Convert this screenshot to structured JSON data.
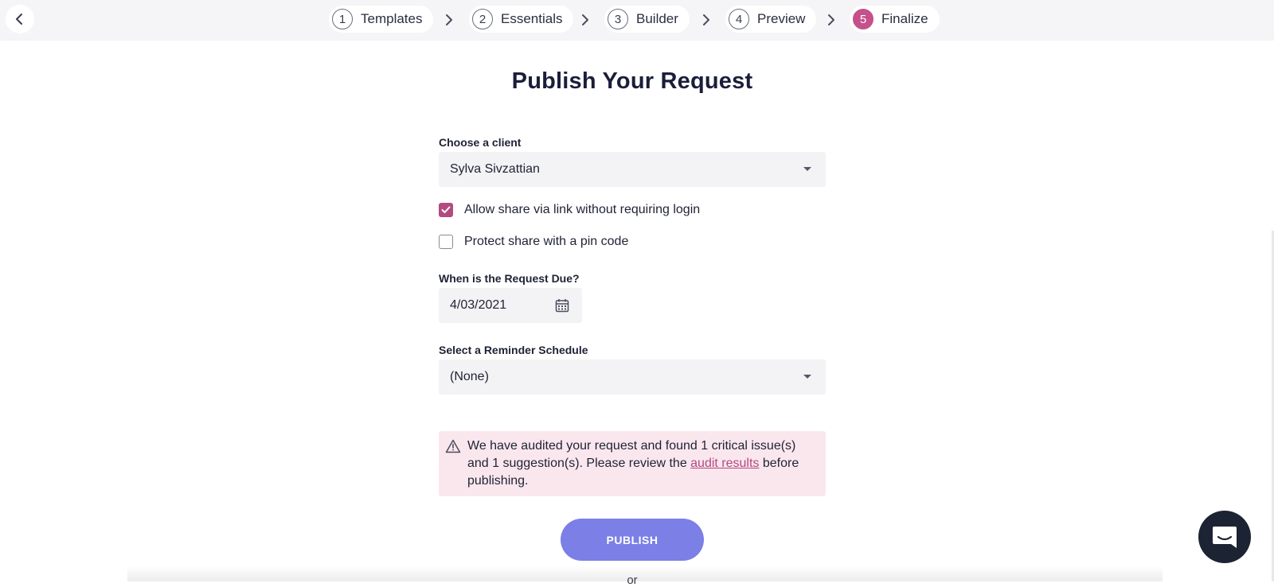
{
  "stepper": {
    "back_label": "",
    "steps": [
      {
        "num": "1",
        "label": "Templates"
      },
      {
        "num": "2",
        "label": "Essentials"
      },
      {
        "num": "3",
        "label": "Builder"
      },
      {
        "num": "4",
        "label": "Preview"
      },
      {
        "num": "5",
        "label": "Finalize",
        "active": true
      }
    ]
  },
  "page": {
    "title": "Publish Your Request"
  },
  "client": {
    "label": "Choose a client",
    "value": "Sylva Sivzattian"
  },
  "options": {
    "share_link_label": "Allow share via link without requiring login",
    "share_link_checked": true,
    "pin_label": "Protect share with a pin code",
    "pin_checked": false
  },
  "due": {
    "label": "When is the Request Due?",
    "value": "4/03/2021"
  },
  "reminder": {
    "label": "Select a Reminder Schedule",
    "value": "(None)"
  },
  "audit": {
    "text_before": "We have audited your request and found 1 critical issue(s) and 1 suggestion(s). Please review the ",
    "link_text": "audit results",
    "text_after": " before publishing."
  },
  "actions": {
    "publish_label": "PUBLISH",
    "or_label": "or"
  },
  "colors": {
    "accent": "#c5508a",
    "checkbox": "#b34a80",
    "publish_button": "#7b7fe6",
    "alert_bg": "#fae7ee",
    "chat_button": "#1c2333"
  },
  "icons": {
    "back": "chevron-left-icon",
    "step_separator": "chevron-right-icon",
    "calendar": "calendar-icon",
    "warning": "warning-triangle-icon",
    "chat": "chat-icon",
    "dropdown": "caret-down-icon"
  }
}
